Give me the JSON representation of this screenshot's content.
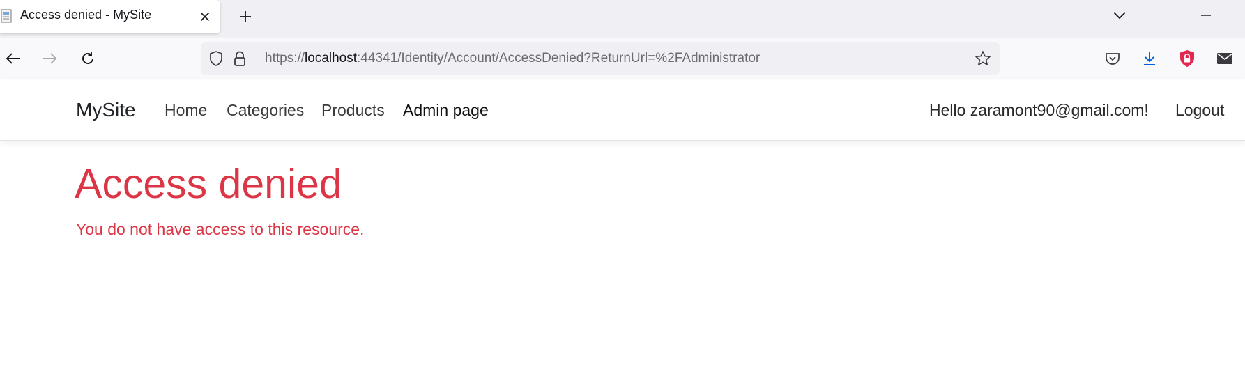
{
  "browser": {
    "tab": {
      "title": "Access denied - MySite",
      "close_icon": "close-icon",
      "favicon_icon": "page-favicon-icon"
    },
    "new_tab_icon": "plus-icon",
    "list_tabs_icon": "chevron-down-icon",
    "minimize_icon": "minimize-icon",
    "nav": {
      "back_icon": "arrow-left-icon",
      "forward_icon": "arrow-right-icon",
      "reload_icon": "reload-icon"
    },
    "url": {
      "scheme": "https://",
      "host": "localhost",
      "rest": ":44341/Identity/Account/AccessDenied?ReturnUrl=%2FAdministrator",
      "shield_icon": "tracking-shield-icon",
      "lock_icon": "lock-icon",
      "bookmark_icon": "star-icon"
    },
    "toolbar_icons": [
      "pocket-icon",
      "download-icon",
      "extension-shield-icon",
      "mail-icon"
    ],
    "colors": {
      "download_blue": "#0060df",
      "shield_red": "#e22850"
    }
  },
  "site": {
    "brand": "MySite",
    "nav_links": [
      "Home",
      "Categories",
      "Products",
      "Admin page"
    ],
    "user_greeting": "Hello zaramont90@gmail.com!",
    "logout_label": "Logout"
  },
  "main": {
    "title": "Access denied",
    "message": "You do not have access to this resource.",
    "accent_color": "#dc3545"
  }
}
